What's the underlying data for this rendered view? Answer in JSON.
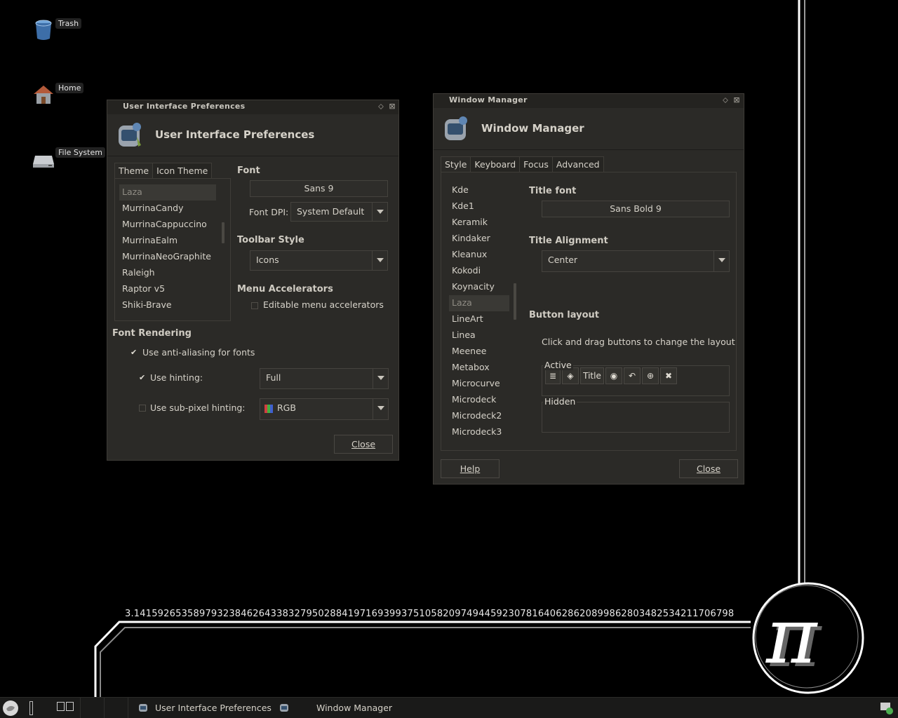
{
  "wallpaper": {
    "pi_digits": "3.14159265358979323846264338327950288419716939937510582097494459230781640628620899862803482534211706798",
    "pi_symbol": "π"
  },
  "desktop": {
    "icons": [
      {
        "label": "Trash",
        "icon": "trash-icon"
      },
      {
        "label": "Home",
        "icon": "home-folder-icon"
      },
      {
        "label": "File System",
        "icon": "drive-icon"
      }
    ]
  },
  "ui_prefs": {
    "title": "User Interface Preferences",
    "heading": "User Interface Preferences",
    "tabs": [
      "Theme",
      "Icon Theme"
    ],
    "themes": [
      "Laza",
      "MurrinaCandy",
      "MurrinaCappuccino",
      "MurrinaEalm",
      "MurrinaNeoGraphite",
      "Raleigh",
      "Raptor v5",
      "Shiki-Brave"
    ],
    "selected_theme": "Laza",
    "font_section": "Font",
    "font_value": "Sans 9",
    "font_dpi_label": "Font DPI:",
    "font_dpi_value": "System Default",
    "toolbar_section": "Toolbar Style",
    "toolbar_value": "Icons",
    "menu_section": "Menu Accelerators",
    "menu_check_label": "Editable menu accelerators",
    "menu_check_checked": false,
    "rendering_section": "Font Rendering",
    "antialias_label": "Use anti-aliasing for fonts",
    "antialias_checked": true,
    "hinting_label": "Use hinting:",
    "hinting_checked": true,
    "hinting_value": "Full",
    "subpixel_label": "Use sub-pixel hinting:",
    "subpixel_checked": false,
    "subpixel_value": "RGB",
    "close_label": "Close",
    "check_mark": "✔"
  },
  "wm": {
    "title": "Window Manager",
    "heading": "Window Manager",
    "tabs": [
      "Style",
      "Keyboard",
      "Focus",
      "Advanced"
    ],
    "themes": [
      "Kde",
      "Kde1",
      "Keramik",
      "Kindaker",
      "Kleanux",
      "Kokodi",
      "Koynacity",
      "Laza",
      "LineArt",
      "Linea",
      "Meenee",
      "Metabox",
      "Microcurve",
      "Microdeck",
      "Microdeck2",
      "Microdeck3"
    ],
    "selected_theme": "Laza",
    "title_font_section": "Title font",
    "title_font_value": "Sans Bold 9",
    "alignment_section": "Title Alignment",
    "alignment_value": "Center",
    "button_layout_section": "Button layout",
    "button_layout_hint": "Click and drag buttons to change the layout",
    "active_label": "Active",
    "hidden_label": "Hidden",
    "title_button_label": "Title",
    "help_label": "Help",
    "close_label": "Close"
  },
  "taskbar": {
    "tasks": [
      "User Interface Preferences",
      "Window Manager"
    ]
  },
  "colors": {
    "desktop_bg": "#000000",
    "window_bg": "#2b2a27",
    "text": "#d6d2c9",
    "selection_bg": "#3a3935"
  }
}
